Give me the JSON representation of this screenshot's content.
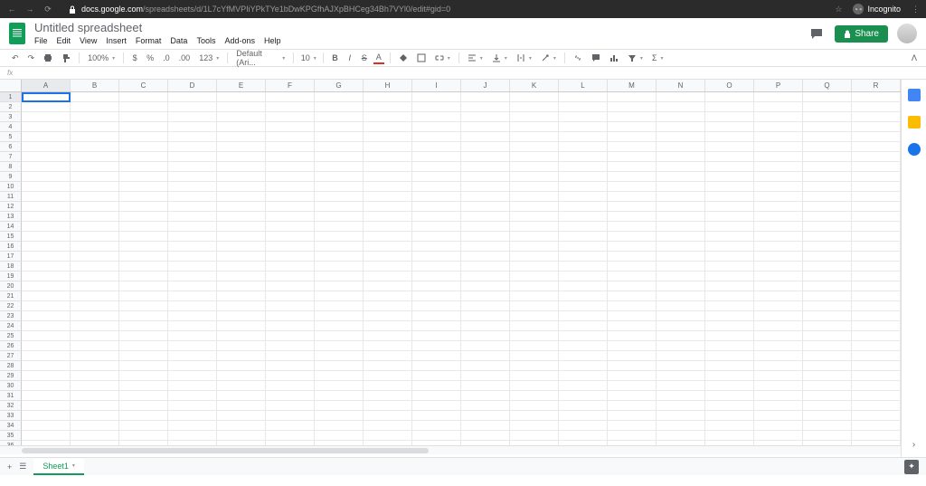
{
  "browser": {
    "url_host": "docs.google.com",
    "url_path": "/spreadsheets/d/1L7cYfMVPIiYPkTYe1bDwKPGfhAJXpBHCeg34Bh7VYl0/edit#gid=0",
    "incognito": "Incognito"
  },
  "header": {
    "title": "Untitled spreadsheet",
    "menu": [
      "File",
      "Edit",
      "View",
      "Insert",
      "Format",
      "Data",
      "Tools",
      "Add-ons",
      "Help"
    ],
    "share": "Share"
  },
  "toolbar": {
    "zoom": "100%",
    "currency": "$",
    "percent": "%",
    "dec_minus": ".0",
    "dec_plus": ".00",
    "more_fmt": "123",
    "font": "Default (Ari...",
    "font_size": "10",
    "bold": "B",
    "italic": "I",
    "strike": "S",
    "text_color": "A"
  },
  "formula": {
    "fx": "fx"
  },
  "grid": {
    "columns": [
      "A",
      "B",
      "C",
      "D",
      "E",
      "F",
      "G",
      "H",
      "I",
      "J",
      "K",
      "L",
      "M",
      "N",
      "O",
      "P",
      "Q",
      "R"
    ],
    "row_count": 36,
    "active_cell": "A1"
  },
  "tabs": {
    "sheet": "Sheet1"
  }
}
